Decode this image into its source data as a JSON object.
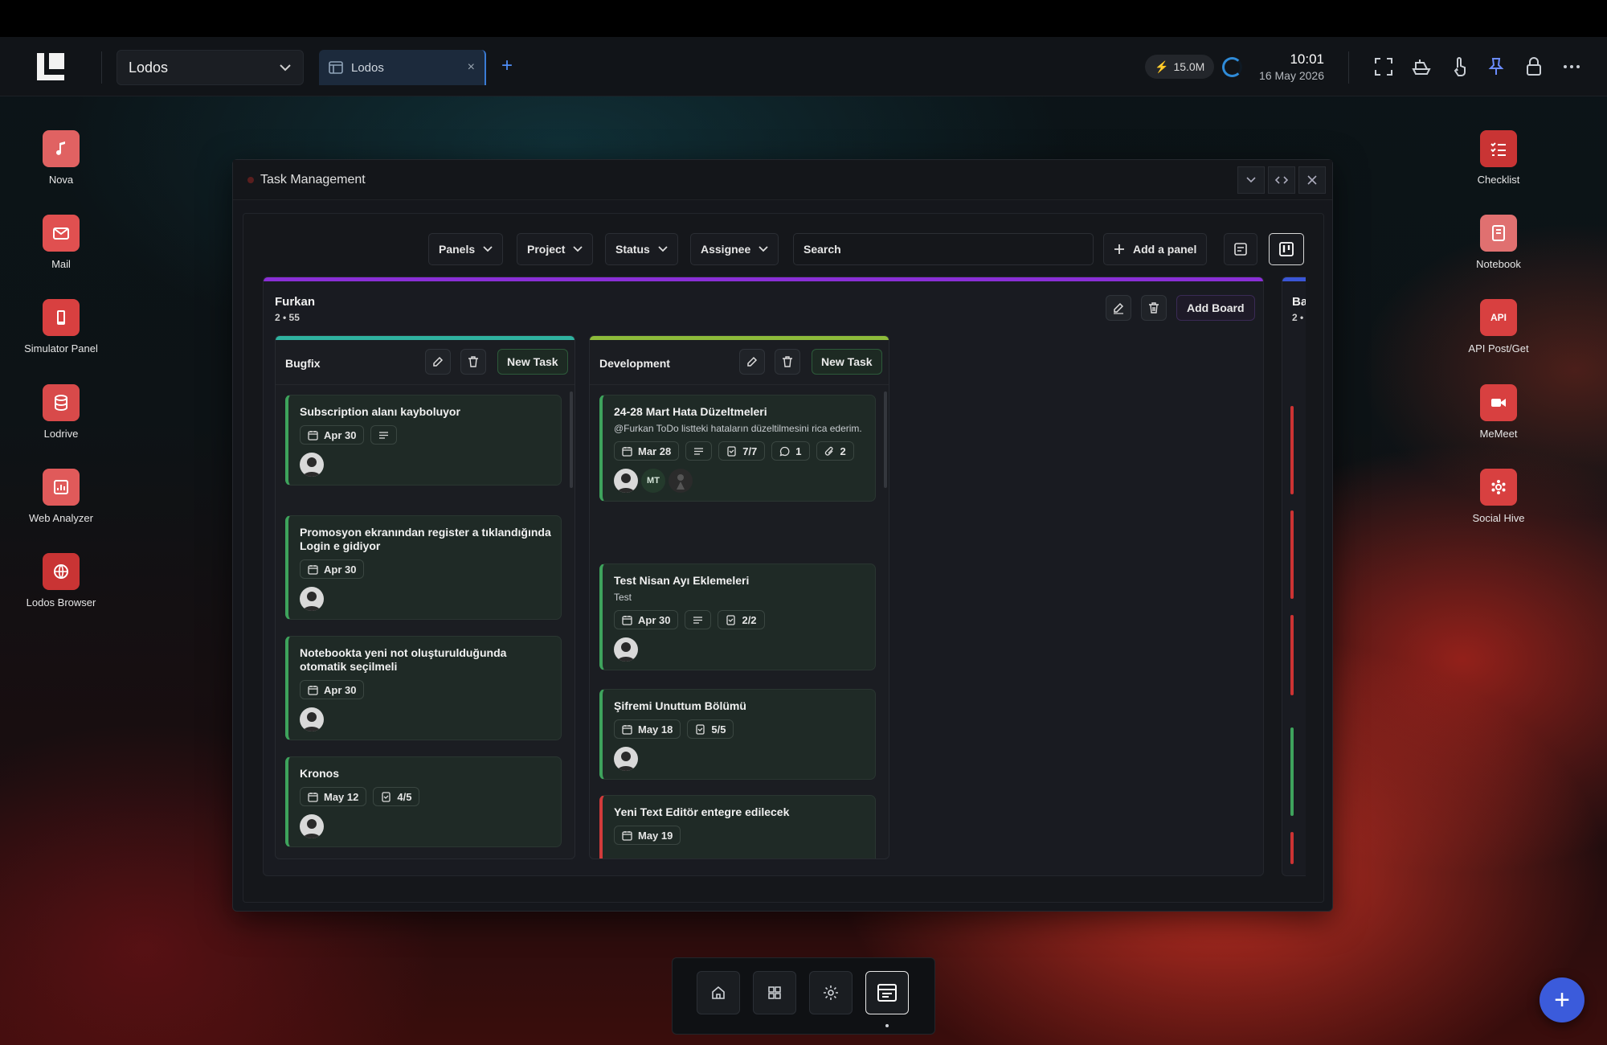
{
  "topbar": {
    "workspace": "Lodos",
    "tab_label": "Lodos",
    "tab_close": "×",
    "add_tab": "+",
    "energy": "15.0M",
    "time": "10:01",
    "date": "16 May 2026"
  },
  "left_dock": [
    {
      "label": "Nova",
      "icon": "music-note-icon",
      "color": "#e06262"
    },
    {
      "label": "Mail",
      "icon": "mail-icon",
      "color": "#e05050"
    },
    {
      "label": "Simulator Panel",
      "icon": "phone-icon",
      "color": "#d84040"
    },
    {
      "label": "Lodrive",
      "icon": "database-icon",
      "color": "#d84a4a"
    },
    {
      "label": "Web Analyzer",
      "icon": "chart-icon",
      "color": "#e05a5a"
    },
    {
      "label": "Lodos Browser",
      "icon": "globe-icon",
      "color": "#c93434"
    }
  ],
  "right_dock": [
    {
      "label": "Checklist",
      "icon": "checklist-icon",
      "color": "#c93434"
    },
    {
      "label": "Notebook",
      "icon": "notebook-icon",
      "color": "#e07070"
    },
    {
      "label": "API Post/Get",
      "icon": "api-icon",
      "color": "#d84040",
      "glyph": "API"
    },
    {
      "label": "MeMeet",
      "icon": "video-icon",
      "color": "#d84040"
    },
    {
      "label": "Social Hive",
      "icon": "hive-icon",
      "color": "#d84040"
    }
  ],
  "window": {
    "title": "Task Management"
  },
  "toolbar": {
    "panels": "Panels",
    "project": "Project",
    "status": "Status",
    "assignee": "Assignee",
    "search_placeholder": "Search",
    "add_panel": "Add a panel"
  },
  "board": {
    "name": "Furkan",
    "meta": "2 • 55",
    "add_board": "Add Board",
    "accent": "#8a2fd6"
  },
  "board2": {
    "name": "Ba",
    "meta": "2 •"
  },
  "panels": [
    {
      "name": "Bugfix",
      "new_task": "New Task",
      "accent": "#2fb2a0",
      "cards": [
        {
          "title": "Subscription alanı kayboluyor",
          "date": "Apr 30",
          "has_desc_icon": true
        },
        {
          "title": "Promosyon ekranından register a tıklandığında Login e gidiyor",
          "date": "Apr 30"
        },
        {
          "title": "Notebookta yeni not oluşturulduğunda otomatik seçilmeli",
          "date": "Apr 30"
        },
        {
          "title": "Kronos",
          "date": "May 12",
          "checklist": "4/5"
        }
      ]
    },
    {
      "name": "Development",
      "new_task": "New Task",
      "accent": "#8dbb3a",
      "cards": [
        {
          "title": "24-28 Mart Hata Düzeltmeleri",
          "desc": "@Furkan ToDo listteki hataların düzeltilmesini rica ederim.",
          "date": "Mar 28",
          "checklist": "7/7",
          "comments": "1",
          "attachments": "2",
          "avatar_initials": "MT"
        },
        {
          "title": "Test Nisan Ayı Eklemeleri",
          "desc": "Test",
          "date": "Apr 30",
          "checklist": "2/2"
        },
        {
          "title": "Şifremi Unuttum Bölümü",
          "date": "May 18",
          "checklist": "5/5"
        },
        {
          "title": "Yeni Text Editör entegre edilecek",
          "date": "May 19"
        }
      ]
    }
  ],
  "fab": "+"
}
